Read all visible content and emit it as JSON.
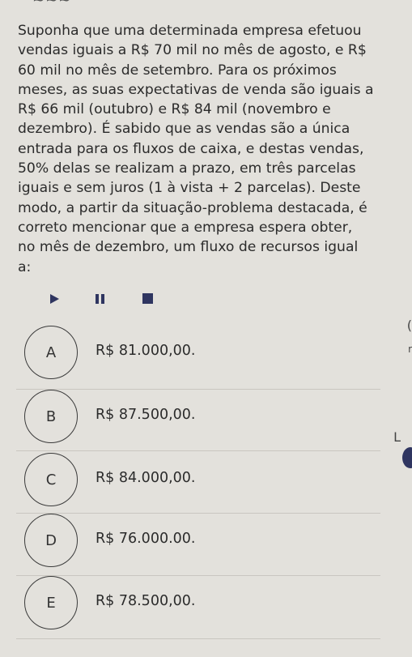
{
  "question": {
    "lines": [
      "Suponha que uma determinada empresa efetuou",
      "vendas iguais a R$ 70 mil no mês de agosto, e R$",
      "60 mil no mês de setembro. Para os próximos",
      "meses, as suas expectativas de venda são iguais a",
      "R$ 66 mil (outubro) e R$ 84 mil (novembro e",
      "dezembro). É sabido que as vendas são a única",
      "entrada para os fluxos de caixa, e destas vendas,",
      "50% delas se realizam a prazo, em três parcelas",
      "iguais e sem juros (1 à vista + 2 parcelas). Deste",
      "modo, a partir da situação-problema destacada, é",
      "correto mencionar que a empresa espera obter,",
      "no mês de dezembro, um fluxo de recursos igual",
      "a:"
    ]
  },
  "media_controls": {
    "play_icon": "play-icon",
    "pause_icon": "pause-icon",
    "stop_icon": "stop-icon",
    "color": "#2f3560"
  },
  "options": [
    {
      "letter": "A",
      "text": "R$ 81.000,00."
    },
    {
      "letter": "B",
      "text": "R$ 87.500,00."
    },
    {
      "letter": "C",
      "text": "R$ 84.000,00."
    },
    {
      "letter": "D",
      "text": "R$ 76.000.00."
    },
    {
      "letter": "E",
      "text": "R$ 78.500,00."
    }
  ]
}
